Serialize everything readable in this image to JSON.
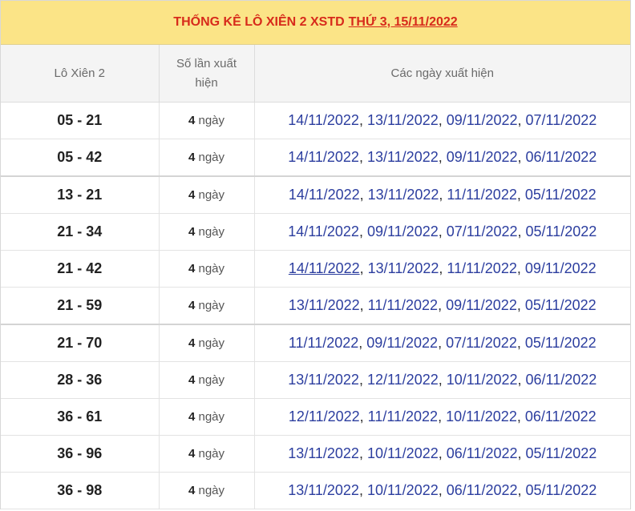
{
  "title": {
    "prefix": "THỐNG KÊ LÔ XIÊN 2 XSTD",
    "date_link": "THỨ 3, 15/11/2022"
  },
  "headers": {
    "col1": "Lô Xiên 2",
    "col2_line1": "Số lần xuất",
    "col2_line2": "hiện",
    "col3": "Các ngày xuất hiện"
  },
  "unit_label": "ngày",
  "rows": [
    {
      "pair": "05 - 21",
      "count": "4",
      "dates": [
        "14/11/2022",
        "13/11/2022",
        "09/11/2022",
        "07/11/2022"
      ]
    },
    {
      "pair": "05 - 42",
      "count": "4",
      "dates": [
        "14/11/2022",
        "13/11/2022",
        "09/11/2022",
        "06/11/2022"
      ]
    },
    {
      "pair": "13 - 21",
      "count": "4",
      "dates": [
        "14/11/2022",
        "13/11/2022",
        "11/11/2022",
        "05/11/2022"
      ]
    },
    {
      "pair": "21 - 34",
      "count": "4",
      "dates": [
        "14/11/2022",
        "09/11/2022",
        "07/11/2022",
        "05/11/2022"
      ]
    },
    {
      "pair": "21 - 42",
      "count": "4",
      "dates": [
        "14/11/2022",
        "13/11/2022",
        "11/11/2022",
        "09/11/2022"
      ]
    },
    {
      "pair": "21 - 59",
      "count": "4",
      "dates": [
        "13/11/2022",
        "11/11/2022",
        "09/11/2022",
        "05/11/2022"
      ]
    },
    {
      "pair": "21 - 70",
      "count": "4",
      "dates": [
        "11/11/2022",
        "09/11/2022",
        "07/11/2022",
        "05/11/2022"
      ]
    },
    {
      "pair": "28 - 36",
      "count": "4",
      "dates": [
        "13/11/2022",
        "12/11/2022",
        "10/11/2022",
        "06/11/2022"
      ]
    },
    {
      "pair": "36 - 61",
      "count": "4",
      "dates": [
        "12/11/2022",
        "11/11/2022",
        "10/11/2022",
        "06/11/2022"
      ]
    },
    {
      "pair": "36 - 96",
      "count": "4",
      "dates": [
        "13/11/2022",
        "10/11/2022",
        "06/11/2022",
        "05/11/2022"
      ]
    },
    {
      "pair": "36 - 98",
      "count": "4",
      "dates": [
        "13/11/2022",
        "10/11/2022",
        "06/11/2022",
        "05/11/2022"
      ]
    }
  ],
  "colors": {
    "title_bg": "#fbe487",
    "title_text": "#d72a1b",
    "header_bg": "#f4f4f4",
    "date_link": "#2c3e9f"
  }
}
